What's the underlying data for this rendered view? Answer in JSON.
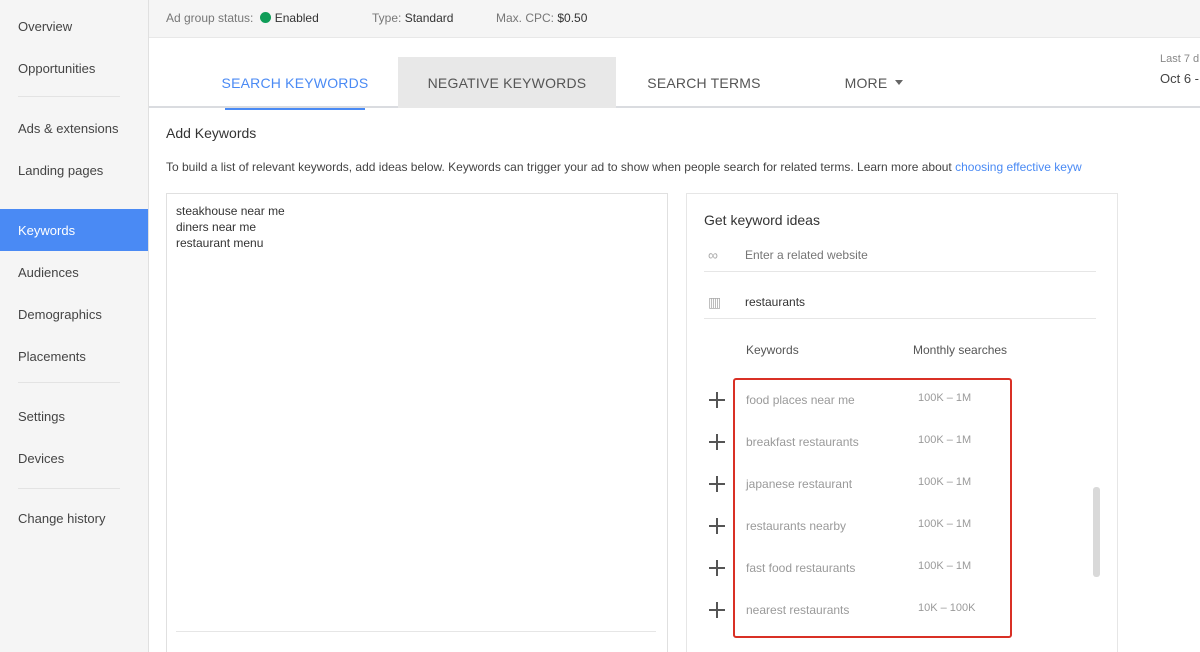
{
  "sidebar": {
    "items": [
      {
        "label": "Overview"
      },
      {
        "label": "Opportunities"
      },
      {
        "label": "Ads & extensions"
      },
      {
        "label": "Landing pages"
      },
      {
        "label": "Keywords"
      },
      {
        "label": "Audiences"
      },
      {
        "label": "Demographics"
      },
      {
        "label": "Placements"
      },
      {
        "label": "Settings"
      },
      {
        "label": "Devices"
      },
      {
        "label": "Change history"
      }
    ],
    "active": "Keywords"
  },
  "status_bar": {
    "status_label": "Ad group status:",
    "status_value": "Enabled",
    "status_color": "#0f9d58",
    "type_label": "Type:",
    "type_value": "Standard",
    "cpc_label": "Max. CPC:",
    "cpc_value": "$0.50"
  },
  "tabs": [
    {
      "label": "SEARCH KEYWORDS"
    },
    {
      "label": "NEGATIVE KEYWORDS"
    },
    {
      "label": "SEARCH TERMS"
    },
    {
      "label": "MORE"
    }
  ],
  "date_range": {
    "label": "Last 7 d",
    "value": "Oct 6 -"
  },
  "add_keywords": {
    "title": "Add Keywords",
    "description": "To build a list of relevant keywords, add ideas below. Keywords can trigger your ad to show when people search for related terms. Learn more about ",
    "link_text": "choosing effective keyw",
    "entered_keywords": [
      "steakhouse near me",
      "diners near me",
      "restaurant menu"
    ]
  },
  "keyword_ideas": {
    "title": "Get keyword ideas",
    "website_placeholder": "Enter a related website",
    "product_value": "restaurants",
    "col_keywords": "Keywords",
    "col_monthly": "Monthly searches",
    "rows": [
      {
        "keyword": "food places near me",
        "monthly": "100K – 1M"
      },
      {
        "keyword": "breakfast restaurants",
        "monthly": "100K – 1M"
      },
      {
        "keyword": "japanese restaurant",
        "monthly": "100K – 1M"
      },
      {
        "keyword": "restaurants nearby",
        "monthly": "100K – 1M"
      },
      {
        "keyword": "fast food restaurants",
        "monthly": "100K – 1M"
      },
      {
        "keyword": "nearest restaurants",
        "monthly": "10K – 100K"
      }
    ]
  },
  "colors": {
    "accent": "#4a8af4",
    "highlight": "#d93025"
  }
}
